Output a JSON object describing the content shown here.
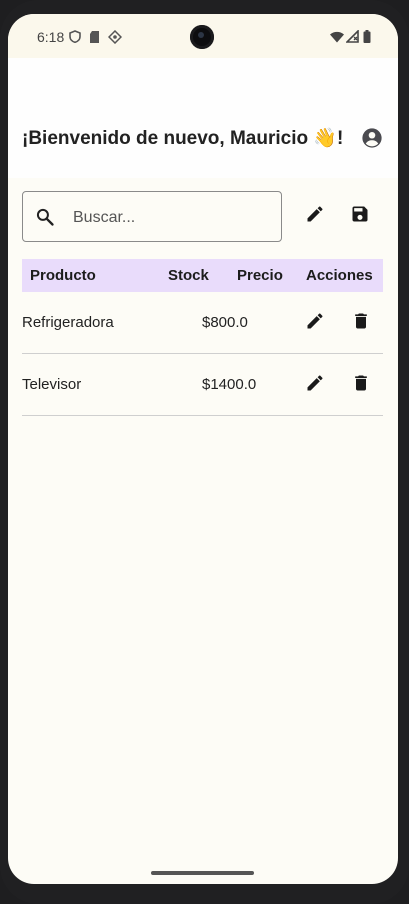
{
  "status_bar": {
    "time": "6:18",
    "icons": [
      "shield-icon",
      "sd-card-icon",
      "vpn-icon",
      "wifi-icon",
      "signal-icon",
      "battery-icon"
    ]
  },
  "header": {
    "title": "¡Bienvenido de nuevo, Mauricio 👋!",
    "account_icon": "account-circle-icon"
  },
  "search": {
    "placeholder": "Buscar...",
    "value": ""
  },
  "toolbar": {
    "edit_icon": "pencil-icon",
    "save_icon": "floppy-disk-icon"
  },
  "table": {
    "columns": [
      "Producto",
      "Stock",
      "Precio",
      "Acciones"
    ],
    "rows": [
      {
        "producto": "Refrigeradora",
        "stock": "",
        "precio": "$800.0"
      },
      {
        "producto": "Televisor",
        "stock": "",
        "precio": "$1400.0"
      }
    ]
  },
  "colors": {
    "background": "#fdfcf6",
    "header_row": "#e9dcfb",
    "text": "#222222"
  }
}
